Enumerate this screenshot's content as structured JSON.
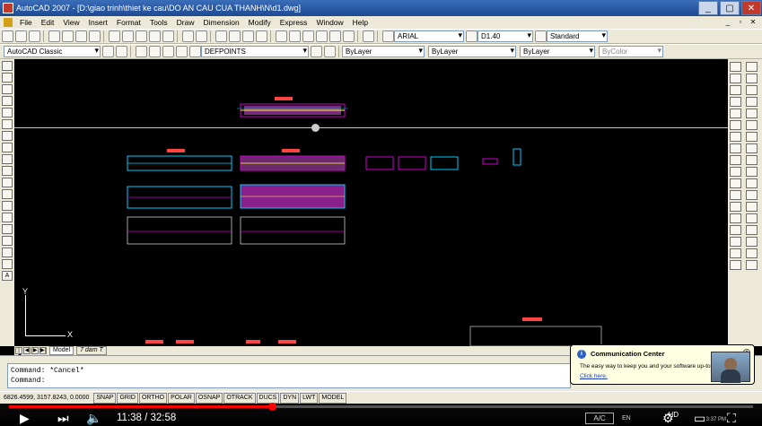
{
  "window": {
    "title": "AutoCAD 2007 - [D:\\giao trinh\\thiet ke cau\\DO AN CAU CUA THANH\\N\\d1.dwg]",
    "controls": [
      "_",
      "▢",
      "✕"
    ]
  },
  "menu": {
    "items": [
      "File",
      "Edit",
      "View",
      "Insert",
      "Format",
      "Tools",
      "Draw",
      "Dimension",
      "Modify",
      "Express",
      "Window",
      "Help"
    ],
    "controls": [
      "_",
      "▫",
      "✕"
    ]
  },
  "toolbar1": {
    "text_style": "ARIAL",
    "dim_style": "D1.40",
    "table_style": "Standard"
  },
  "toolbar2": {
    "workspace": "AutoCAD Classic",
    "layer": "DEFPOINTS",
    "color": "ByLayer",
    "linetype": "ByLayer",
    "lineweight": "ByLayer",
    "plot_style": "ByColor"
  },
  "ucs": {
    "x_label": "X",
    "y_label": "Y"
  },
  "tabs": {
    "nav": [
      "|◀",
      "◀",
      "▶",
      "▶|"
    ],
    "items": [
      "Model",
      "7 dam T"
    ]
  },
  "command": {
    "history": "Command: *Cancel*",
    "prompt": "Command:"
  },
  "status": {
    "coords": "6826.4599, 3157.8243, 0.0000",
    "toggles": [
      "SNAP",
      "GRID",
      "ORTHO",
      "POLAR",
      "OSNAP",
      "OTRACK",
      "DUCS",
      "DYN",
      "LWT",
      "MODEL"
    ]
  },
  "notification": {
    "title": "Communication Center",
    "body": "The easy way to keep you and your software up-to",
    "link": "Click here."
  },
  "player": {
    "current_time": "11:38",
    "duration": "32:58",
    "time_display": "11:38 / 32:58",
    "progress_fraction": 0.353,
    "keyboard_lang": "EN",
    "ac_label": "A/C",
    "clock": "3:37 PM",
    "hd_badge": "HD"
  },
  "colors": {
    "accent_red": "#ff0000",
    "title_blue": "#1d4a93",
    "drawing_bg": "#000000"
  }
}
